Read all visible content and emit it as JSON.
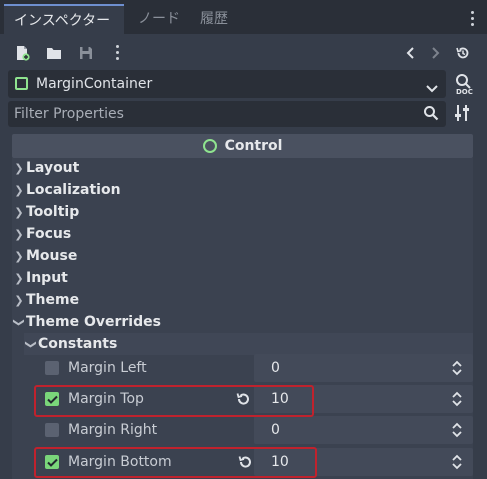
{
  "tabs": [
    {
      "label": "インスペクター",
      "active": true
    },
    {
      "label": "ノード",
      "active": false
    },
    {
      "label": "履歴",
      "active": false
    }
  ],
  "object_selector": {
    "value": "MarginContainer"
  },
  "filter": {
    "placeholder": "Filter Properties"
  },
  "section": {
    "title": "Control"
  },
  "groups": [
    {
      "label": "Layout"
    },
    {
      "label": "Localization"
    },
    {
      "label": "Tooltip"
    },
    {
      "label": "Focus"
    },
    {
      "label": "Mouse"
    },
    {
      "label": "Input"
    },
    {
      "label": "Theme"
    },
    {
      "label": "Theme Overrides"
    }
  ],
  "subgroup": {
    "label": "Constants"
  },
  "properties": [
    {
      "label": "Margin Left",
      "value": "0",
      "checked": false
    },
    {
      "label": "Margin Top",
      "value": "10",
      "checked": true
    },
    {
      "label": "Margin Right",
      "value": "0",
      "checked": false
    },
    {
      "label": "Margin Bottom",
      "value": "10",
      "checked": true
    }
  ],
  "colors": {
    "background": "#363d4a",
    "accent": "#6e8fcf",
    "highlight": "#c0222d",
    "check": "#7ad67a"
  }
}
